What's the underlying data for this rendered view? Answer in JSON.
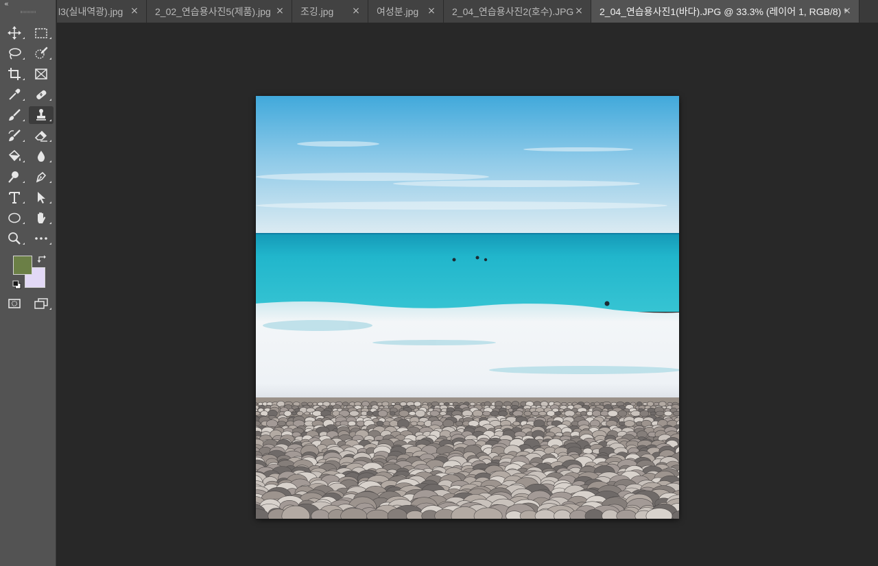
{
  "toolbar": {
    "collapse_glyph": "«",
    "tools": [
      {
        "name": "move-tool",
        "icon": "move-icon"
      },
      {
        "name": "rectangular-marquee-tool",
        "icon": "marquee-icon"
      },
      {
        "name": "lasso-tool",
        "icon": "lasso-icon"
      },
      {
        "name": "quick-selection-tool",
        "icon": "quick-selection-icon"
      },
      {
        "name": "crop-tool",
        "icon": "crop-icon"
      },
      {
        "name": "frame-tool",
        "icon": "frame-icon"
      },
      {
        "name": "eyedropper-tool",
        "icon": "eyedropper-icon"
      },
      {
        "name": "healing-brush-tool",
        "icon": "bandage-icon"
      },
      {
        "name": "brush-tool",
        "icon": "brush-icon"
      },
      {
        "name": "clone-stamp-tool",
        "icon": "stamp-icon",
        "active": true
      },
      {
        "name": "history-brush-tool",
        "icon": "history-brush-icon"
      },
      {
        "name": "eraser-tool",
        "icon": "eraser-icon"
      },
      {
        "name": "paint-bucket-tool",
        "icon": "paint-bucket-icon"
      },
      {
        "name": "blur-tool",
        "icon": "drop-icon"
      },
      {
        "name": "dodge-tool",
        "icon": "dodge-icon"
      },
      {
        "name": "pen-tool",
        "icon": "pen-icon"
      },
      {
        "name": "type-tool",
        "icon": "type-icon"
      },
      {
        "name": "path-selection-tool",
        "icon": "arrow-icon"
      },
      {
        "name": "ellipse-tool",
        "icon": "ellipse-icon"
      },
      {
        "name": "hand-tool",
        "icon": "hand-icon"
      },
      {
        "name": "zoom-tool",
        "icon": "zoom-icon"
      },
      {
        "name": "edit-toolbar",
        "icon": "more-icon"
      },
      {
        "name": "quick-mask-mode",
        "icon": "quick-mask-icon"
      },
      {
        "name": "screen-mode",
        "icon": "screen-mode-icon"
      }
    ],
    "foreground_color": "#6b7f46",
    "background_color": "#e2d9f6"
  },
  "tabs": [
    {
      "label": "l3(실내역광).jpg",
      "active": false
    },
    {
      "label": "2_02_연습용사진5(제품).jpg",
      "active": false
    },
    {
      "label": "조깅.jpg",
      "active": false
    },
    {
      "label": "여성분.jpg",
      "active": false
    },
    {
      "label": "2_04_연습용사진2(호수).JPG",
      "active": false
    },
    {
      "label": "2_04_연습용사진1(바다).JPG @ 33.3% (레이어 1, RGB/8) *",
      "active": true
    }
  ],
  "tab_close_glyph": "×",
  "colors": {
    "workspace": "#282828",
    "toolbar": "#535353",
    "tabbar": "#3a3a3a",
    "active_tab": "#535353",
    "sky_top": "#41a9db",
    "sky_bottom": "#dcebf2",
    "sea": "#21b6cc",
    "foam": "#f3f6f8",
    "pebbles": "#8f8a87"
  }
}
